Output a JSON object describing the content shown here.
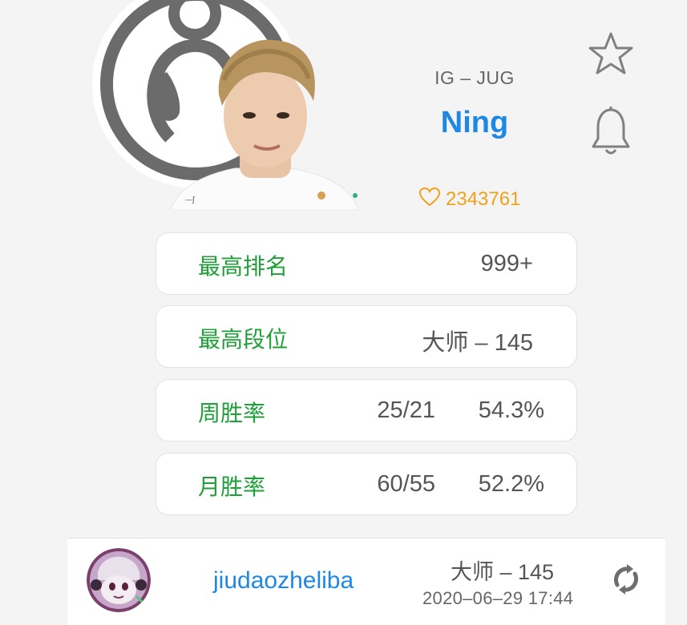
{
  "player": {
    "team_position": "IG – JUG",
    "name": "Ning",
    "likes": "2343761"
  },
  "stats": [
    {
      "label": "最高排名",
      "value": "999+"
    },
    {
      "label": "最高段位",
      "value": "大师 – 145"
    },
    {
      "label": "周胜率",
      "record": "25/21",
      "rate": "54.3%"
    },
    {
      "label": "月胜率",
      "record": "60/55",
      "rate": "52.2%"
    }
  ],
  "account": {
    "name": "jiudaozheliba",
    "rank": "大师 – 145",
    "updated": "2020–06–29 17:44"
  },
  "icons": {
    "star": "star-outline-icon",
    "bell": "bell-outline-icon",
    "heart": "heart-outline-icon",
    "refresh": "refresh-icon"
  },
  "colors": {
    "accent_blue": "#1e88e5",
    "label_green": "#1fa038",
    "likes_orange": "#f0a11c"
  }
}
